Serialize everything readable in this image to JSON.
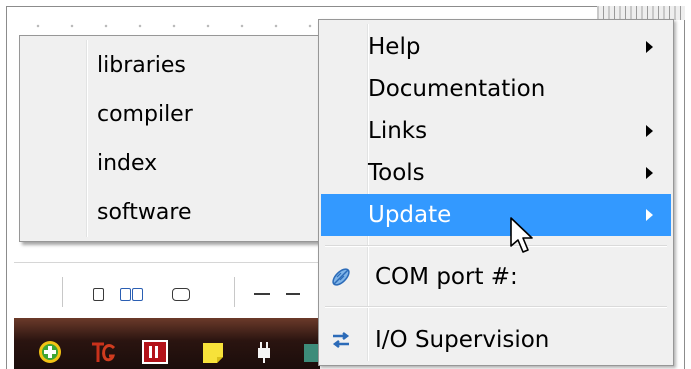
{
  "colors": {
    "highlight": "#3399ff",
    "menu_bg": "#f0f0f0"
  },
  "submenu": {
    "items": [
      {
        "label": "libraries"
      },
      {
        "label": "compiler"
      },
      {
        "label": "index"
      },
      {
        "label": "software"
      }
    ]
  },
  "menu": {
    "items": [
      {
        "label": "Help",
        "submenu": true
      },
      {
        "label": "Documentation",
        "submenu": false
      },
      {
        "label": "Links",
        "submenu": true
      },
      {
        "label": "Tools",
        "submenu": true
      },
      {
        "label": "Update",
        "submenu": true,
        "selected": true
      },
      {
        "label": "COM port #:",
        "icon": "satellite-icon"
      },
      {
        "label": "I/O Supervision",
        "icon": "transfer-arrows-icon"
      }
    ]
  }
}
